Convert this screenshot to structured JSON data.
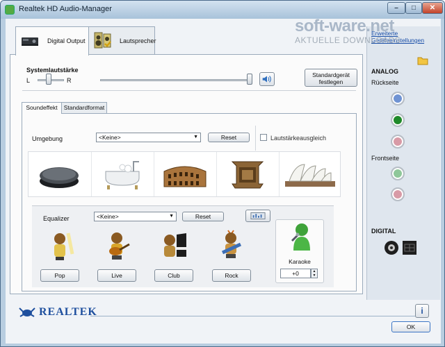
{
  "window": {
    "title": "Realtek HD Audio-Manager",
    "minimize": "–",
    "maximize": "□",
    "close": "✕"
  },
  "device_tabs": [
    {
      "label": "Digital Output",
      "icon": "digital-output-icon"
    },
    {
      "label": "Lautsprecher",
      "icon": "speaker-icon"
    }
  ],
  "volume": {
    "label": "Systemlautstärke",
    "left": "L",
    "right": "R",
    "default_device_button": [
      "Standardgerät",
      "festlegen"
    ]
  },
  "sub_tabs": [
    "Soundeffekt",
    "Standardformat"
  ],
  "environment": {
    "label": "Umgebung",
    "selected": "<Keine>",
    "reset": "Reset",
    "loudness_label": "Lautstärkeausgleich",
    "presets": [
      "stone-icon",
      "bathtub-icon",
      "colosseum-icon",
      "opera-house-icon",
      "sydney-opera-icon"
    ]
  },
  "equalizer": {
    "label": "Equalizer",
    "selected": "<Keine>",
    "reset": "Reset",
    "presets": [
      {
        "label": "Pop",
        "icon": "pop-singer-icon"
      },
      {
        "label": "Live",
        "icon": "guitarist-icon"
      },
      {
        "label": "Club",
        "icon": "pianist-icon"
      },
      {
        "label": "Rock",
        "icon": "rock-guitarist-icon"
      }
    ]
  },
  "karaoke": {
    "label": "Karaoke",
    "value": "+0"
  },
  "sidebar": {
    "links": [
      "Erweiterte",
      "Geräteeinstellungen"
    ],
    "analog": "ANALOG",
    "rear": "Rückseite",
    "front": "Frontseite",
    "digital": "DIGITAL"
  },
  "footer": {
    "brand": "REALTEK",
    "ok": "OK",
    "info": "i"
  },
  "watermark": {
    "title": "soft-ware.net",
    "subtitle": "AKTUELLE DOWNLOADS"
  },
  "colors": {
    "jack_blue": "#6f93d3",
    "jack_green": "#1f8a2a",
    "jack_pink": "#d89aa6",
    "jack_lightgreen": "#8fc79a"
  }
}
